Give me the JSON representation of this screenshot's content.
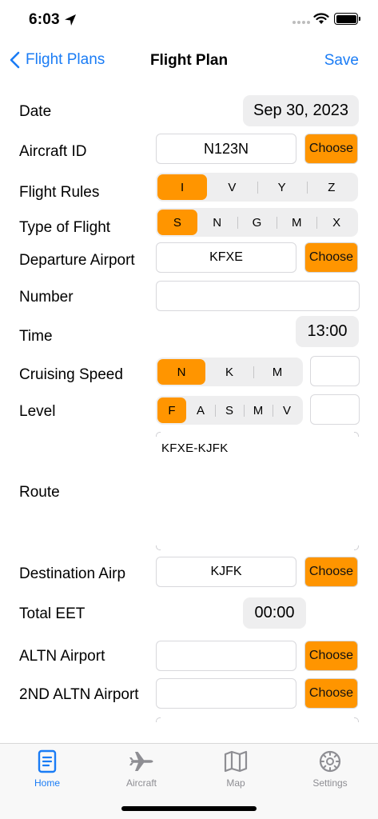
{
  "status": {
    "time": "6:03"
  },
  "nav": {
    "back_label": "Flight Plans",
    "title": "Flight Plan",
    "save_label": "Save"
  },
  "form": {
    "date": {
      "label": "Date",
      "value": "Sep 30, 2023"
    },
    "aircraft_id": {
      "label": "Aircraft ID",
      "value": "N123N",
      "choose": "Choose"
    },
    "flight_rules": {
      "label": "Flight Rules",
      "options": [
        "I",
        "V",
        "Y",
        "Z"
      ],
      "selected": "I"
    },
    "type_of_flight": {
      "label": "Type of Flight",
      "options": [
        "S",
        "N",
        "G",
        "M",
        "X"
      ],
      "selected": "S"
    },
    "departure_airport": {
      "label": "Departure Airport",
      "value": "KFXE",
      "choose": "Choose"
    },
    "number": {
      "label": "Number",
      "value": ""
    },
    "time": {
      "label": "Time",
      "value": "13:00"
    },
    "cruising_speed": {
      "label": "Cruising Speed",
      "options": [
        "N",
        "K",
        "M"
      ],
      "selected": "N",
      "value": ""
    },
    "level": {
      "label": "Level",
      "options": [
        "F",
        "A",
        "S",
        "M",
        "V"
      ],
      "selected": "F",
      "value": ""
    },
    "route": {
      "label": "Route",
      "value": "KFXE-KJFK"
    },
    "destination_airport": {
      "label": "Destination Airp",
      "value": "KJFK",
      "choose": "Choose"
    },
    "total_eet": {
      "label": "Total EET",
      "value": "00:00"
    },
    "altn_airport": {
      "label": "ALTN Airport",
      "value": "",
      "choose": "Choose"
    },
    "second_altn_airport": {
      "label": "2ND ALTN Airport",
      "value": "",
      "choose": "Choose"
    }
  },
  "tabs": [
    {
      "label": "Home",
      "icon": "document-icon",
      "active": true
    },
    {
      "label": "Aircraft",
      "icon": "airplane-icon",
      "active": false
    },
    {
      "label": "Map",
      "icon": "map-icon",
      "active": false
    },
    {
      "label": "Settings",
      "icon": "gear-icon",
      "active": false
    }
  ],
  "colors": {
    "accent": "#1a7cf5",
    "selected": "#ff9500",
    "pill": "#eeeeef"
  }
}
